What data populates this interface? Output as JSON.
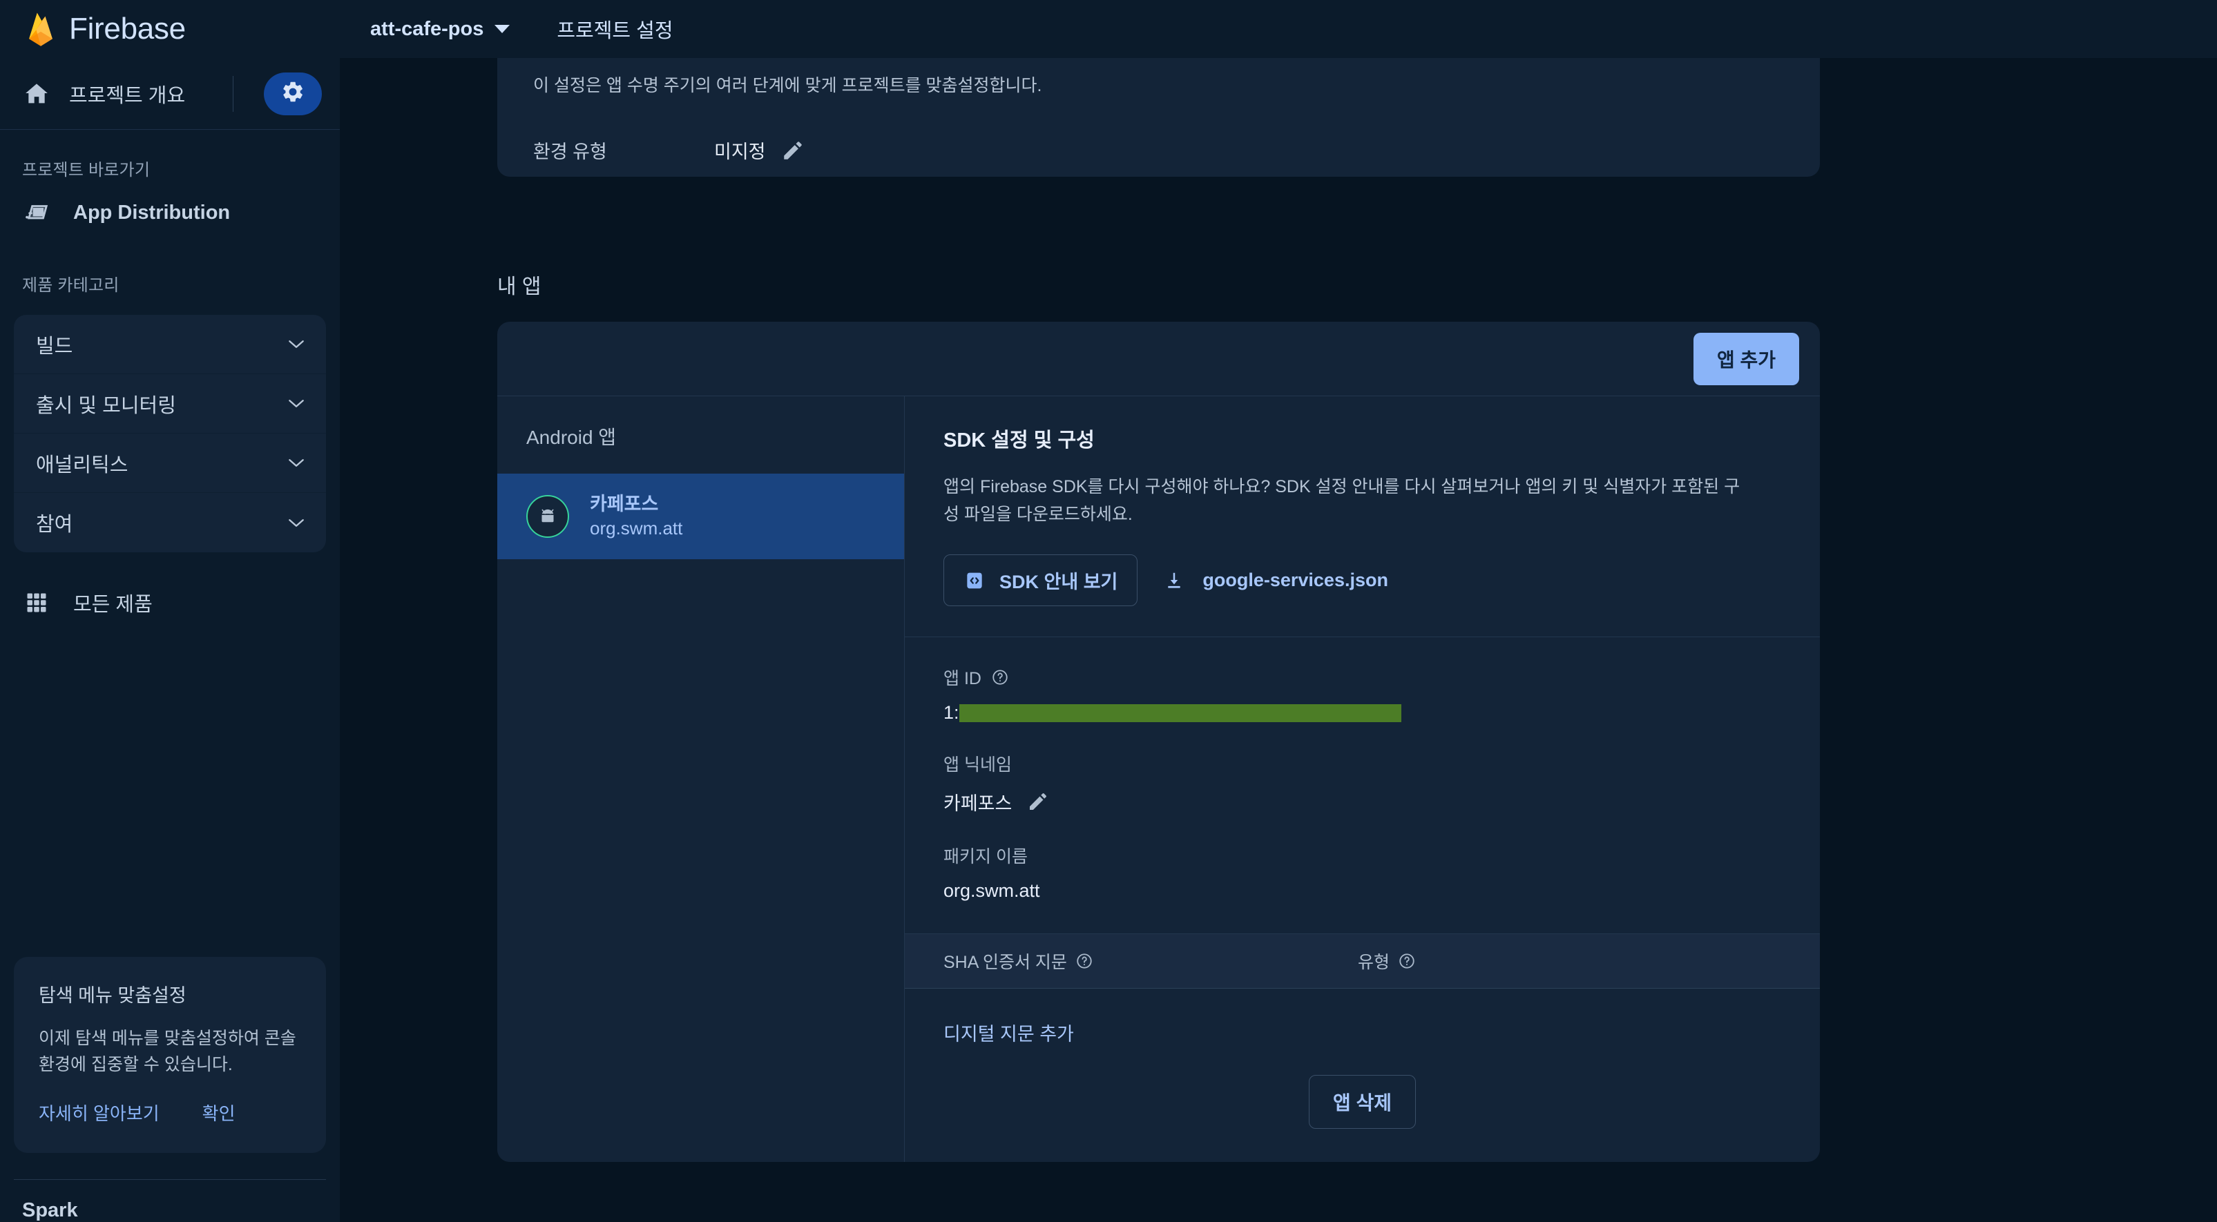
{
  "topbar": {
    "brand": "Firebase",
    "project_name": "att-cafe-pos",
    "project_settings_link": "프로젝트 설정"
  },
  "sidebar": {
    "header": {
      "label": "프로젝트 개요",
      "home_icon": "home-icon",
      "settings_icon": "gear-icon"
    },
    "shortcuts_label": "프로젝트 바로가기",
    "shortcuts": [
      {
        "label": "App Distribution",
        "icon": "app-distribution-icon"
      }
    ],
    "categories_label": "제품 카테고리",
    "categories": [
      {
        "label": "빌드"
      },
      {
        "label": "출시 및 모니터링"
      },
      {
        "label": "애널리틱스"
      },
      {
        "label": "참여"
      }
    ],
    "all_products": "모든 제품",
    "promo": {
      "title": "탐색 메뉴 맞춤설정",
      "body": "이제 탐색 메뉴를 맞춤설정하여 콘솔 환경에 집중할 수 있습니다.",
      "learn_more": "자세히 알아보기",
      "confirm": "확인"
    },
    "plan": "Spark"
  },
  "main": {
    "environment": {
      "description": "이 설정은 앱 수명 주기의 여러 단계에 맞게 프로젝트를 맞춤설정합니다.",
      "label": "환경 유형",
      "value": "미지정"
    },
    "my_apps": {
      "section_title": "내 앱",
      "add_app_button": "앱 추가",
      "list_header": "Android 앱",
      "apps": [
        {
          "name": "카페포스",
          "package": "org.swm.att",
          "platform_icon": "android-icon",
          "selected": true
        }
      ],
      "detail": {
        "sdk": {
          "heading": "SDK 설정 및 구성",
          "paragraph": "앱의 Firebase SDK를 다시 구성해야 하나요? SDK 설정 안내를 다시 살펴보거나 앱의 키 및 식별자가 포함된 구성 파일을 다운로드하세요.",
          "guide_button": "SDK 안내 보기",
          "download_link": "google-services.json"
        },
        "fields": [
          {
            "label": "앱 ID",
            "value": "1:",
            "redacted": true,
            "has_help": true
          },
          {
            "label": "앱 닉네임",
            "value": "카페포스",
            "editable": true,
            "has_help": false
          },
          {
            "label": "패키지 이름",
            "value": "org.swm.att",
            "has_help": false
          }
        ],
        "fingerprints": {
          "col_sha": "SHA 인증서 지문",
          "col_type": "유형",
          "add_link": "디지털 지문 추가"
        },
        "delete_button": "앱 삭제"
      }
    }
  },
  "colors": {
    "page_bg": "#061421",
    "panel_bg": "#0b1b2b",
    "card_bg": "#132438",
    "accent_blue": "#8ab4f8",
    "link_blue": "#a8c7fa",
    "selected_row": "#1a4480",
    "gear_blue": "#12469c",
    "android_green": "#37d39b",
    "redaction_green": "#4c7d26",
    "flame_yellow": "#ffc24a"
  }
}
